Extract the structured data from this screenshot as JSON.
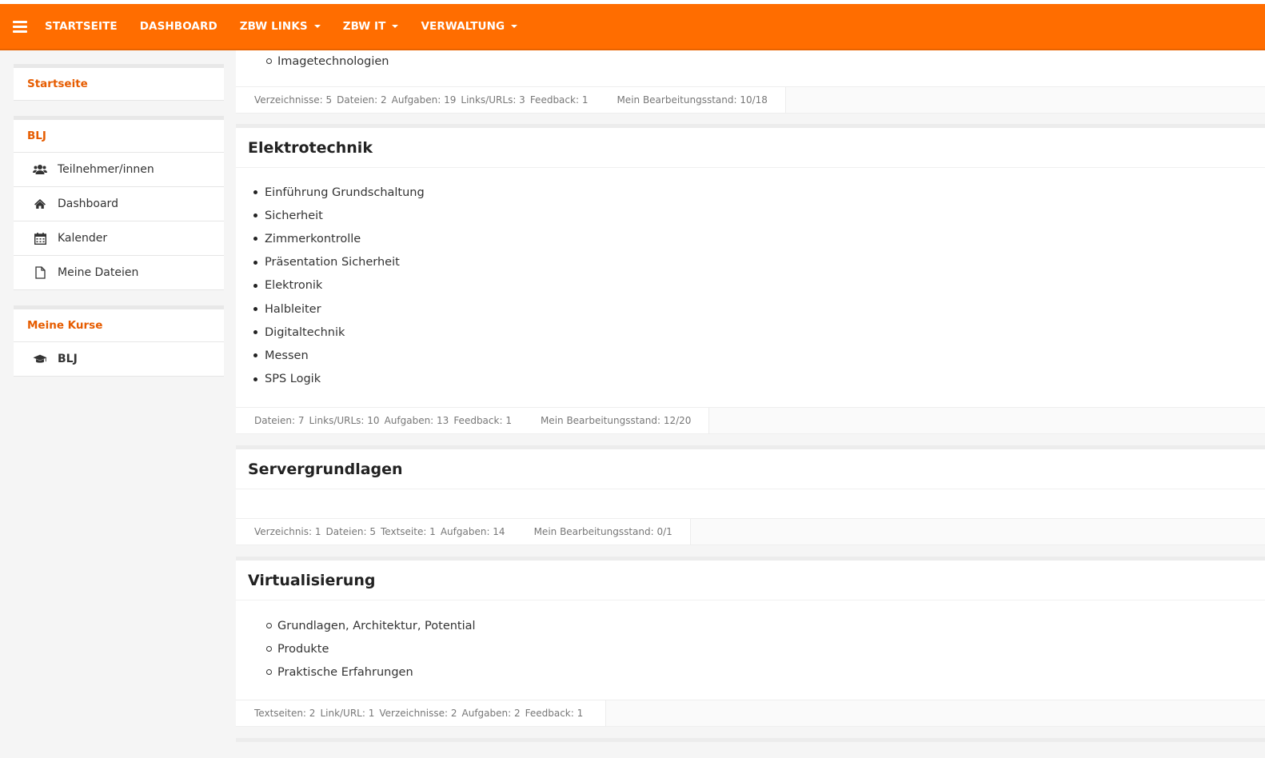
{
  "nav": {
    "items": [
      {
        "label": "STARTSEITE",
        "dropdown": false
      },
      {
        "label": "DASHBOARD",
        "dropdown": false
      },
      {
        "label": "ZBW LINKS",
        "dropdown": true
      },
      {
        "label": "ZBW IT",
        "dropdown": true
      },
      {
        "label": "VERWALTUNG",
        "dropdown": true
      }
    ]
  },
  "sidebar": {
    "home_block": {
      "title": "Startseite"
    },
    "blj_block": {
      "title": "BLJ",
      "items": [
        {
          "label": "Teilnehmer/innen",
          "icon": "users-icon"
        },
        {
          "label": "Dashboard",
          "icon": "home-icon"
        },
        {
          "label": "Kalender",
          "icon": "calendar-icon"
        },
        {
          "label": "Meine Dateien",
          "icon": "file-icon"
        }
      ]
    },
    "courses_block": {
      "title": "Meine Kurse",
      "items": [
        {
          "label": "BLJ",
          "icon": "graduation-cap-icon"
        }
      ]
    }
  },
  "sections": {
    "top_partial": {
      "items": [
        "Imagetechnologien"
      ],
      "stats": [
        "Verzeichnisse: 5",
        "Dateien: 2",
        "Aufgaben: 19",
        "Links/URLs: 3",
        "Feedback: 1"
      ],
      "progress": "Mein Bearbeitungsstand: 10/18"
    },
    "elektrotechnik": {
      "title": "Elektrotechnik",
      "items": [
        "Einführung Grundschaltung",
        "Sicherheit",
        "Zimmerkontrolle",
        "Präsentation Sicherheit",
        "Elektronik",
        "Halbleiter",
        "Digitaltechnik",
        "Messen",
        "SPS Logik"
      ],
      "stats": [
        "Dateien: 7",
        "Links/URLs: 10",
        "Aufgaben: 13",
        "Feedback: 1"
      ],
      "progress": "Mein Bearbeitungsstand: 12/20"
    },
    "servergrundlagen": {
      "title": "Servergrundlagen",
      "stats": [
        "Verzeichnis: 1",
        "Dateien: 5",
        "Textseite: 1",
        "Aufgaben: 14"
      ],
      "progress": "Mein Bearbeitungsstand: 0/1"
    },
    "virtualisierung": {
      "title": "Virtualisierung",
      "items": [
        "Grundlagen, Architektur, Potential",
        "Produkte",
        "Praktische Erfahrungen"
      ],
      "stats": [
        "Textseiten: 2",
        "Link/URL: 1",
        "Verzeichnisse: 2",
        "Aufgaben: 2",
        "Feedback: 1"
      ]
    }
  },
  "colors": {
    "accent": "#ff6d00",
    "sidebar_title": "#e65c00"
  }
}
